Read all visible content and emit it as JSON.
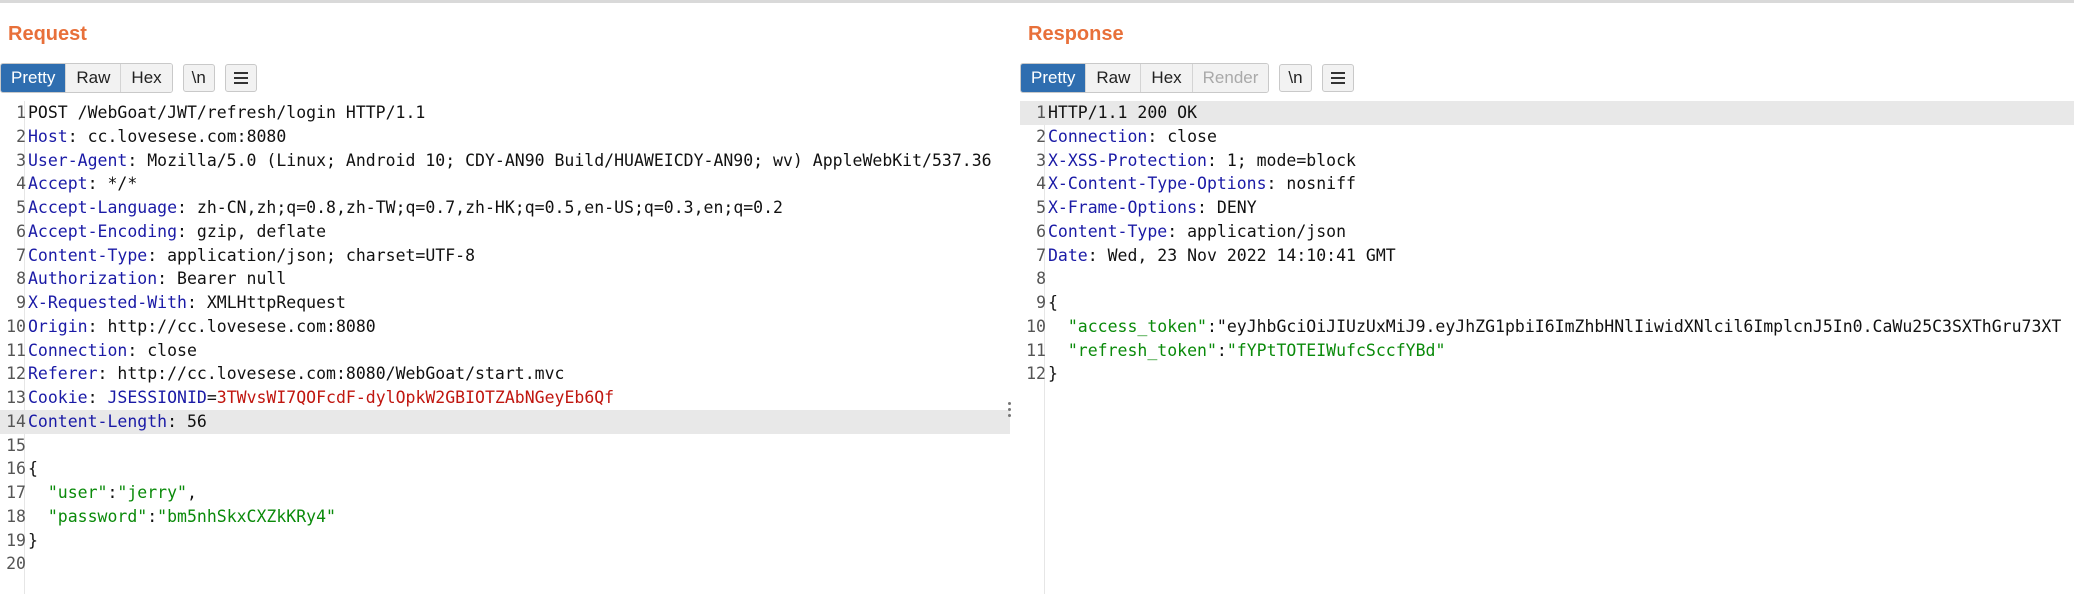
{
  "request": {
    "title": "Request",
    "tabs": [
      "Pretty",
      "Raw",
      "Hex"
    ],
    "active_tab": "Pretty",
    "newline_button": "\\n",
    "lines": [
      "POST /WebGoat/JWT/refresh/login HTTP/1.1",
      "Host: cc.lovesese.com:8080",
      "User-Agent: Mozilla/5.0 (Linux; Android 10; CDY-AN90 Build/HUAWEICDY-AN90; wv) AppleWebKit/537.36",
      "Accept: */*",
      "Accept-Language: zh-CN,zh;q=0.8,zh-TW;q=0.7,zh-HK;q=0.5,en-US;q=0.3,en;q=0.2",
      "Accept-Encoding: gzip, deflate",
      "Content-Type: application/json; charset=UTF-8",
      "Authorization: Bearer null",
      "X-Requested-With: XMLHttpRequest",
      "Origin: http://cc.lovesese.com:8080",
      "Connection: close",
      "Referer: http://cc.lovesese.com:8080/WebGoat/start.mvc",
      "Cookie: JSESSIONID=3TWvsWI7QOFcdF-dylOpkW2GBIOTZAbNGeyEb6Qf",
      "Content-Length: 56",
      "",
      "{",
      "  \"user\":\"jerry\",",
      "  \"password\":\"bm5nhSkxCXZkKRy4\"",
      "}",
      ""
    ],
    "highlighted_line": 14
  },
  "response": {
    "title": "Response",
    "tabs": [
      "Pretty",
      "Raw",
      "Hex",
      "Render"
    ],
    "active_tab": "Pretty",
    "disabled_tab": "Render",
    "newline_button": "\\n",
    "lines": [
      "HTTP/1.1 200 OK",
      "Connection: close",
      "X-XSS-Protection: 1; mode=block",
      "X-Content-Type-Options: nosniff",
      "X-Frame-Options: DENY",
      "Content-Type: application/json",
      "Date: Wed, 23 Nov 2022 14:10:41 GMT",
      "",
      "{",
      "  \"access_token\":\"eyJhbGciOiJIUzUxMiJ9.eyJhZG1pbiI6ImZhbHNlIiwidXNlcil6ImplcnJ5In0.CaWu25C3SXThGru73XT",
      "  \"refresh_token\":\"fYPtTOTEIWufcSccfYBd\"",
      "}"
    ],
    "highlighted_line": 1
  },
  "colors": {
    "accent": "#e8703a",
    "active_tab": "#2f6eb0",
    "header_key": "#1a1aa6",
    "string": "#0a8a0a",
    "cookie_value": "#c0160f"
  }
}
